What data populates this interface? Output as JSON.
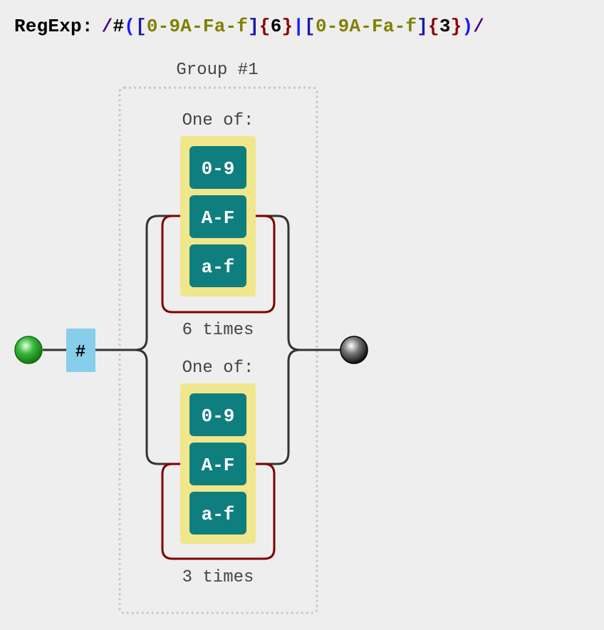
{
  "header": {
    "label": "RegExp:",
    "tokens": [
      {
        "text": "/",
        "color": "#4b0082"
      },
      {
        "text": "#",
        "color": "#000000"
      },
      {
        "text": "(",
        "color": "#1a1aff"
      },
      {
        "text": "[",
        "color": "#1a1aa6"
      },
      {
        "text": "0-9A-Fa-f",
        "color": "#808000"
      },
      {
        "text": "]",
        "color": "#1a1aa6"
      },
      {
        "text": "{",
        "color": "#8b0000"
      },
      {
        "text": "6",
        "color": "#000000"
      },
      {
        "text": "}",
        "color": "#8b0000"
      },
      {
        "text": "|",
        "color": "#1a1aff"
      },
      {
        "text": "[",
        "color": "#1a1aa6"
      },
      {
        "text": "0-9A-Fa-f",
        "color": "#808000"
      },
      {
        "text": "]",
        "color": "#1a1aa6"
      },
      {
        "text": "{",
        "color": "#8b0000"
      },
      {
        "text": "3",
        "color": "#000000"
      },
      {
        "text": "}",
        "color": "#8b0000"
      },
      {
        "text": ")",
        "color": "#1a1aff"
      },
      {
        "text": "/",
        "color": "#4b0082"
      }
    ]
  },
  "diagram": {
    "group_label": "Group #1",
    "literal": "#",
    "branches": [
      {
        "one_of_label": "One of:",
        "ranges": [
          "0-9",
          "A-F",
          "a-f"
        ],
        "repeat_label": "6 times"
      },
      {
        "one_of_label": "One of:",
        "ranges": [
          "0-9",
          "A-F",
          "a-f"
        ],
        "repeat_label": "3 times"
      }
    ]
  },
  "colors": {
    "background": "#eeeeee",
    "literal_box": "#87ceeb",
    "charset_box": "#f0e68c",
    "range_box": "#0f7e7e",
    "repeat_loop": "#800000",
    "line": "#333333",
    "group_border": "#c8c8c8",
    "start_node": "#22aa22",
    "end_node": "#333333"
  }
}
